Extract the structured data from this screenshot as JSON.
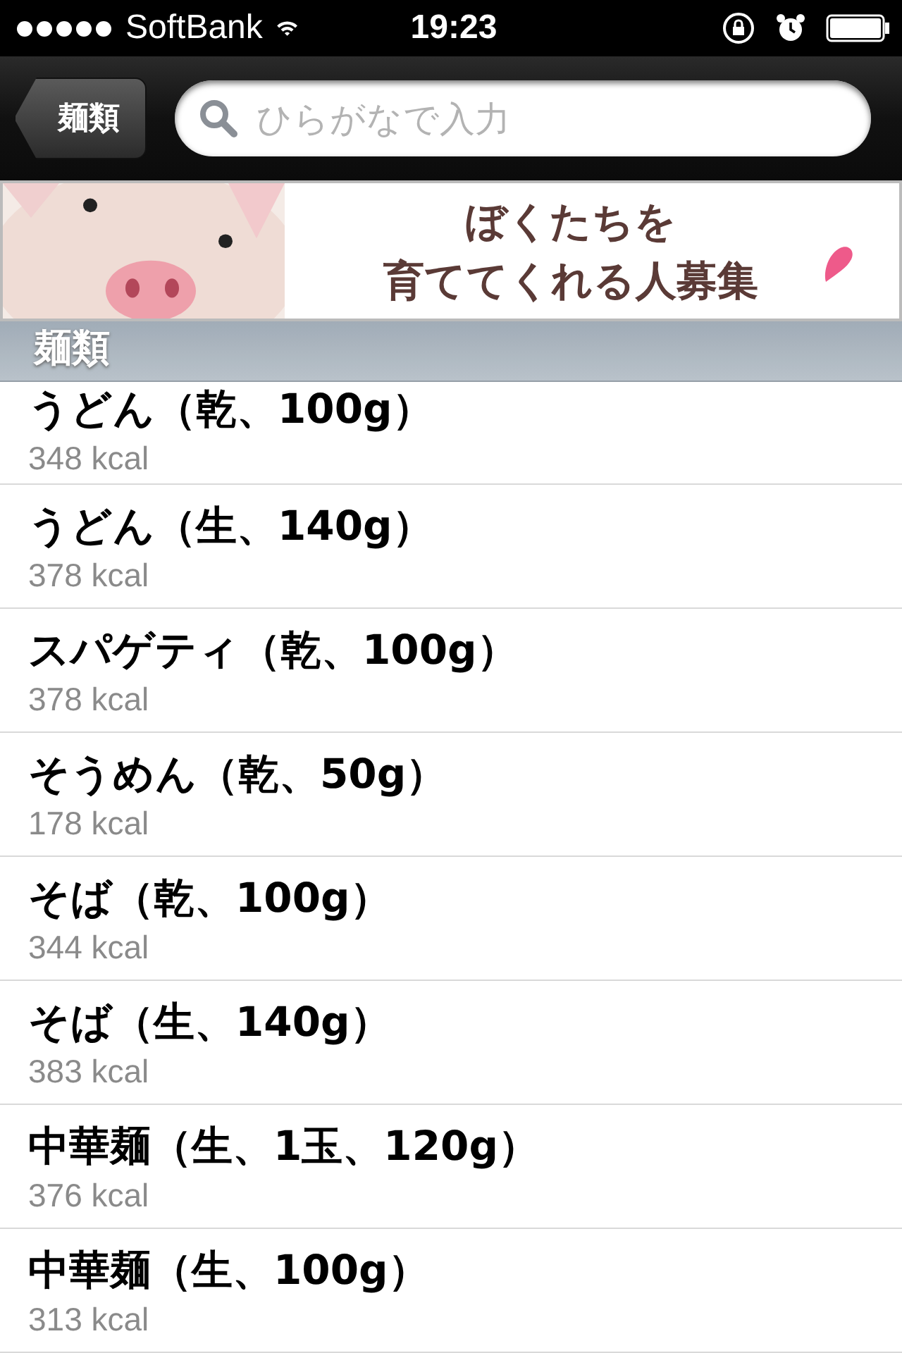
{
  "status_bar": {
    "carrier": "SoftBank",
    "time": "19:23"
  },
  "nav": {
    "back": "麺類",
    "search": {
      "placeholder": "ひらがなで入力"
    }
  },
  "banner": {
    "kind": "picture",
    "lines": [
      "ぼくたちを",
      "育ててくれる人募集"
    ]
  },
  "section": {
    "title": "麺類"
  },
  "items": [
    {
      "name": "うどん（乾、100g）",
      "kcal": "348 kcal"
    },
    {
      "name": "うどん（生、140g）",
      "kcal": "378 kcal"
    },
    {
      "name": "スパゲティ（乾、100g）",
      "kcal": "378 kcal"
    },
    {
      "name": "そうめん（乾、50g）",
      "kcal": "178 kcal"
    },
    {
      "name": "そば（乾、100g）",
      "kcal": "344 kcal"
    },
    {
      "name": "そば（生、140g）",
      "kcal": "383 kcal"
    },
    {
      "name": "中華麺（生、1玉、120g）",
      "kcal": "376 kcal"
    },
    {
      "name": "中華麺（生、100g）",
      "kcal": "313 kcal"
    }
  ]
}
